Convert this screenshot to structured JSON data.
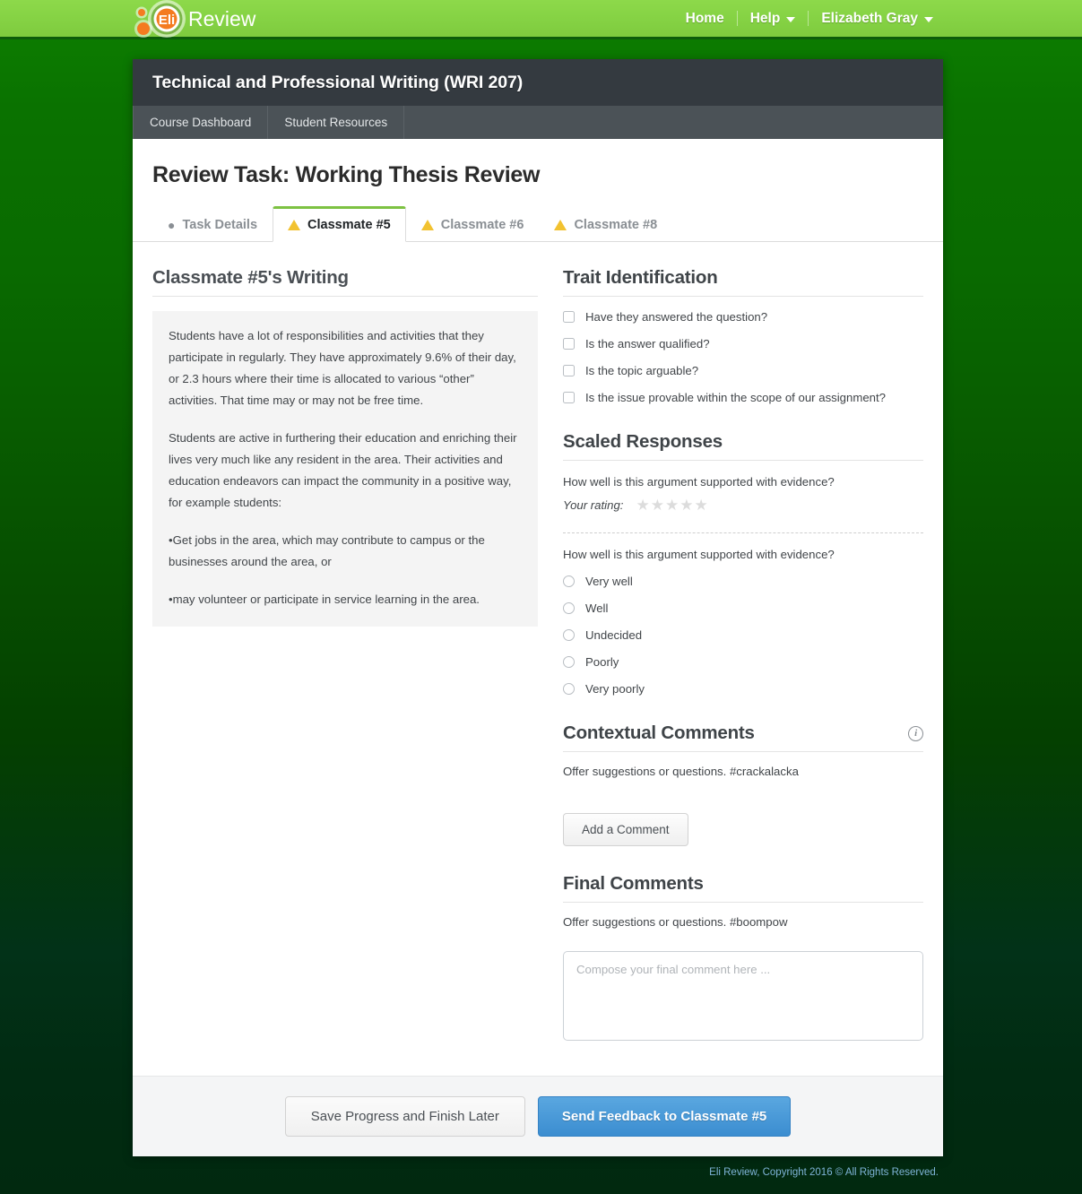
{
  "topbar": {
    "logo_text": "Review",
    "logo_mark_text": "Eli",
    "nav": [
      {
        "label": "Home",
        "caret": false
      },
      {
        "label": "Help",
        "caret": true
      },
      {
        "label": "Elizabeth Gray",
        "caret": true
      }
    ]
  },
  "course": {
    "title": "Technical and Professional Writing (WRI 207)",
    "nav": [
      {
        "label": "Course Dashboard"
      },
      {
        "label": "Student Resources"
      }
    ]
  },
  "page": {
    "title": "Review Task: Working Thesis Review"
  },
  "tabs": [
    {
      "label": "Task Details",
      "icon": "map-pin-icon",
      "active": false
    },
    {
      "label": "Classmate #5",
      "icon": "warning-triangle-icon",
      "active": true
    },
    {
      "label": "Classmate #6",
      "icon": "warning-triangle-icon",
      "active": false
    },
    {
      "label": "Classmate #8",
      "icon": "warning-triangle-icon",
      "active": false
    }
  ],
  "writing": {
    "heading": "Classmate #5's Writing",
    "paragraphs": [
      "Students have a lot of responsibilities and activities that they participate in regularly. They have approximately 9.6% of their day, or 2.3 hours where their time is allocated to various “other” activities. That time may or may not be free time.",
      "Students are active in furthering their education and enriching their lives very much like any resident in the area. Their activities and education endeavors can impact the community in a positive way, for example students:",
      "•Get jobs in the area, which may contribute to campus or the businesses around the area, or",
      "•may volunteer or participate in service learning in the area."
    ]
  },
  "trait_identification": {
    "heading": "Trait Identification",
    "items": [
      {
        "label": "Have they answered the question?",
        "checked": false
      },
      {
        "label": "Is the answer qualified?",
        "checked": false
      },
      {
        "label": "Is the topic arguable?",
        "checked": false
      },
      {
        "label": "Is the issue provable within the scope of our assignment?",
        "checked": false
      }
    ]
  },
  "scaled_responses": {
    "heading": "Scaled Responses",
    "star_question": "How well is this argument supported with evidence?",
    "rating_label": "Your rating:",
    "star_count": 5,
    "stars_filled": 0,
    "radio_question": "How well is this argument supported with evidence?",
    "radio_options": [
      {
        "label": "Very well",
        "selected": false
      },
      {
        "label": "Well",
        "selected": false
      },
      {
        "label": "Undecided",
        "selected": false
      },
      {
        "label": "Poorly",
        "selected": false
      },
      {
        "label": "Very poorly",
        "selected": false
      }
    ]
  },
  "contextual_comments": {
    "heading": "Contextual Comments",
    "info_icon": "info-circle-icon",
    "prompt": "Offer suggestions or questions. #crackalacka",
    "add_button": "Add a Comment"
  },
  "final_comments": {
    "heading": "Final Comments",
    "prompt": "Offer suggestions or questions. #boompow",
    "textarea_placeholder": "Compose your final comment here ...",
    "textarea_value": ""
  },
  "actions": {
    "save_label": "Save Progress and Finish Later",
    "send_label": "Send Feedback to Classmate #5"
  },
  "footer": {
    "copyright": "Eli Review, Copyright 2016 © All Rights Reserved."
  },
  "colors": {
    "topbar_green": "#84d143",
    "page_bg_top_green": "#0d8000",
    "page_bg_bottom_green": "#01290f",
    "course_header": "#343a40",
    "course_nav": "#4b5257",
    "tab_active_border": "#7dc242",
    "warning_yellow": "#f2c230",
    "primary_button_blue": "#3b8dd0",
    "logo_orange": "#f47b20"
  }
}
